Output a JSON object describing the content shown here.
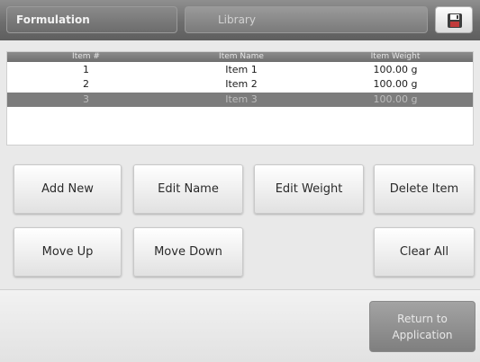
{
  "tabs": [
    {
      "label": "Formulation",
      "active": true
    },
    {
      "label": "Library",
      "active": false
    }
  ],
  "save_icon": "floppy-disk-icon",
  "table": {
    "headers": [
      "Item #",
      "Item Name",
      "Item Weight"
    ],
    "rows": [
      {
        "num": "1",
        "name": "Item 1",
        "weight": "100.00 g",
        "selected": false
      },
      {
        "num": "2",
        "name": "Item 2",
        "weight": "100.00 g",
        "selected": false
      },
      {
        "num": "3",
        "name": "Item 3",
        "weight": "100.00 g",
        "selected": true
      }
    ]
  },
  "buttons": {
    "add_new": "Add New",
    "edit_name": "Edit Name",
    "edit_weight": "Edit Weight",
    "delete_item": "Delete Item",
    "move_up": "Move Up",
    "move_down": "Move Down",
    "clear_all": "Clear All"
  },
  "return_button": {
    "line1": "Return to",
    "line2": "Application"
  },
  "colors": {
    "header_gray": "#6e6e6e",
    "selected_row": "#7c7c7c",
    "button_face": "#f4f4f4"
  }
}
